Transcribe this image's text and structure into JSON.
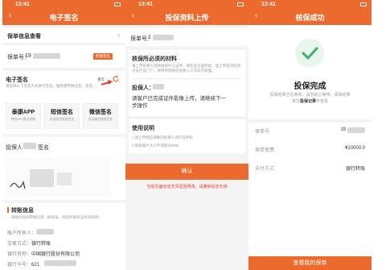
{
  "common": {
    "time": "13:41"
  },
  "panel1": {
    "title": "电子签名",
    "section_view": "保单信息查看",
    "policy_label": "保单号：",
    "policy_value": "19",
    "change_btn": "更换签名",
    "sign_title": "电子签名",
    "sign_desc": "请选择以下签名方式进行签名，推荐使用微信签，签名...",
    "resign": "重签",
    "options": [
      {
        "title": "泰康APP",
        "sub": "前往APP签名领取"
      },
      {
        "title": "短信签名",
        "sub": "发送短信链接签名"
      },
      {
        "title": "微信签名",
        "sub": "发送微信链接签名"
      }
    ],
    "insurer_label": "投保人",
    "insurer_suffix": "签名",
    "transfer_title": "转账信息",
    "transfer_desc": "请核对您的转账信息（如有误，请及时联系业务员修改）",
    "account_holder_label": "账户所有人：",
    "account_holder_value": "",
    "trans_method_label": "交易方式：",
    "trans_method_value": "银行转账",
    "bank_label": "银行名称：",
    "bank_value": "中国银行股份有限公司",
    "card_label": "银行卡号：",
    "card_value": "621"
  },
  "panel2": {
    "title": "投保资料上传",
    "policy_label": "保单号：",
    "policy_value": "1",
    "materials_title": "核保所必须的材料",
    "materials_desc": "请上传投保人现场拍照片与证件，请在此页面停留，提上传成功后请点击产品门户，保单审批将在投保入工作日内处理。",
    "insurer_label": "投保人：",
    "instruction": "请客户已完成证件影像上传，请继续下一步操作",
    "usage_title": "使用说明",
    "usage_1": "1.请上传相应清晰的投保人资料证件照",
    "usage_2": "2.每张图片大小不得超过5MB",
    "confirm_btn": "确认",
    "warning": "当前页面信息无须返回修改，请确保信息无误"
  },
  "panel3": {
    "title": "核保成功",
    "headline": "投保完成",
    "desc_1": "投保结果正在审核，请您耐心等待。承保结果",
    "desc_2_pre": "将在",
    "desc_2_link": "投保记录",
    "desc_2_post": "中查看",
    "rows": [
      {
        "label": "保单号",
        "value": "19"
      },
      {
        "label": "保单保费",
        "value": "¥10000.0"
      },
      {
        "label": "支付方式",
        "value": "银行转账"
      }
    ],
    "bottom_btn": "查看我的保单"
  },
  "colors": {
    "brand": "#ec6a2d",
    "success": "#3bb06a",
    "warning": "#e53b2d"
  }
}
